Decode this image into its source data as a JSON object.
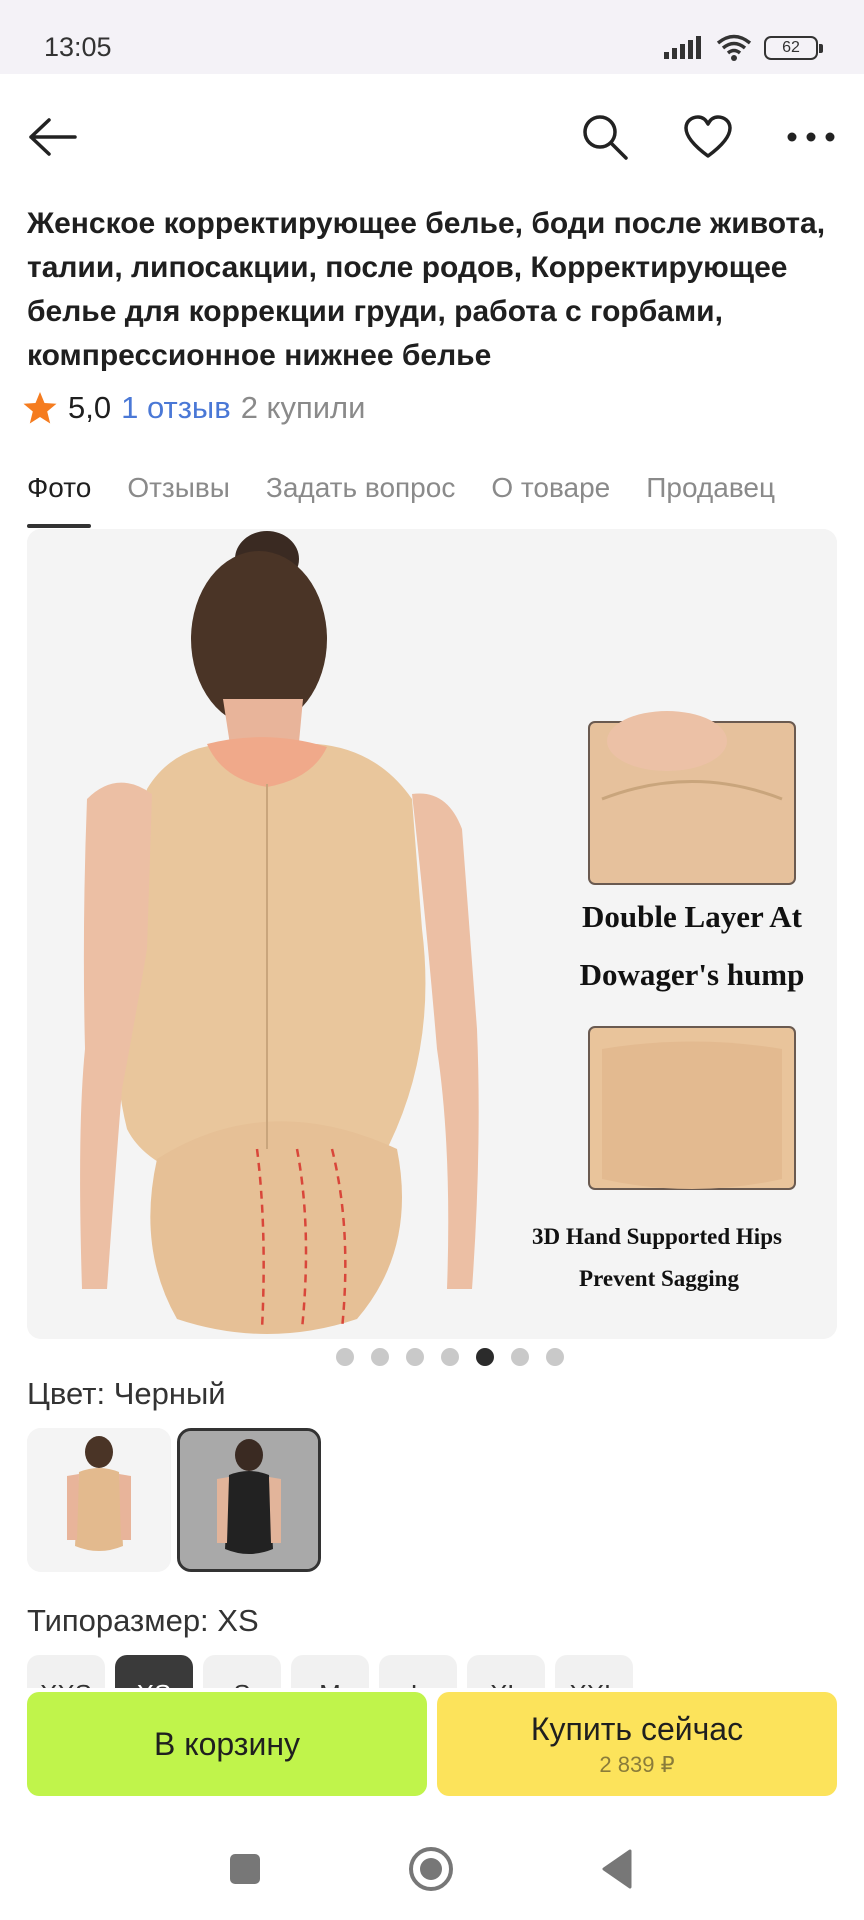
{
  "status": {
    "time": "13:05",
    "battery": "62"
  },
  "header": {
    "back_icon": "arrow-left-icon",
    "search_icon": "search-icon",
    "favorite_icon": "heart-icon",
    "more_icon": "more-dots-icon"
  },
  "product": {
    "title": "Женское корректирующее белье, боди после живота, талии, липосакции, после родов, Корректирующее белье для коррекции груди, работа с горбами, компрессионное нижнее белье",
    "rating": "5,0",
    "reviews": "1 отзыв",
    "bought": "2 купили"
  },
  "tabs": [
    "Фото",
    "Отзывы",
    "Задать вопрос",
    "О товаре",
    "Продавец"
  ],
  "gallery": {
    "caption1_line1": "Double Layer At",
    "caption1_line2": "Dowager's hump",
    "caption2_line1": "3D Hand Supported Hips",
    "caption2_line2": "Prevent Sagging",
    "slides_total": 7,
    "active_slide": 5
  },
  "color": {
    "label": "Цвет: Черный",
    "options": [
      "beige",
      "black"
    ],
    "selected": "black"
  },
  "size": {
    "label": "Типоразмер: XS",
    "options": [
      "XXS",
      "XS",
      "S",
      "M",
      "L",
      "XL",
      "XXL"
    ],
    "selected": "XS"
  },
  "actions": {
    "cart_label": "В корзину",
    "buy_label": "Купить сейчас",
    "buy_price": "2 839 ₽"
  },
  "colors": {
    "cart_bg": "#c0f44b",
    "buy_bg": "#fce35b",
    "link": "#4a78d6",
    "star": "#f57c1f"
  }
}
